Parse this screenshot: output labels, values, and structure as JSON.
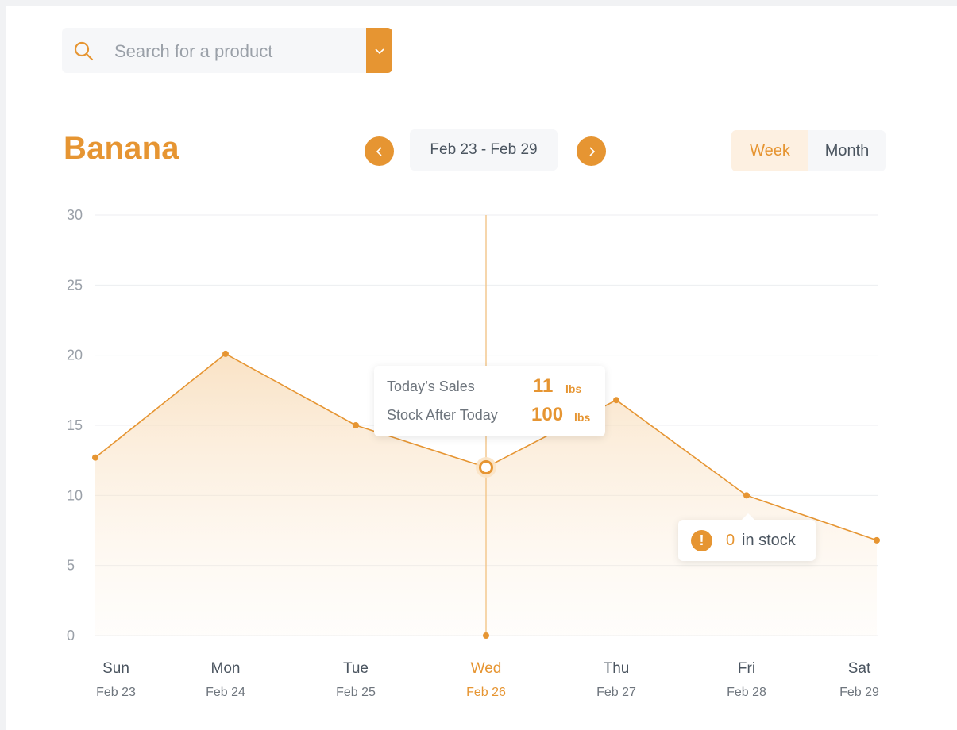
{
  "search": {
    "placeholder": "Search for a product",
    "icon": "search-icon",
    "dropdown_icon": "chevron-down-icon"
  },
  "product": {
    "title": "Banana"
  },
  "date_nav": {
    "range": "Feb 23 - Feb 29",
    "prev_icon": "chevron-left-icon",
    "next_icon": "chevron-right-icon"
  },
  "view_toggle": {
    "options": [
      "Week",
      "Month"
    ],
    "active": "Week"
  },
  "tooltip": {
    "sales_label": "Today’s Sales",
    "sales_value": "11",
    "sales_unit": "lbs",
    "stock_label": "Stock After Today",
    "stock_value": "100",
    "stock_unit": "lbs"
  },
  "stock_alert": {
    "icon": "warning-icon",
    "glyph": "!",
    "qty": "0",
    "text": "in stock"
  },
  "colors": {
    "accent": "#e69532",
    "accent_light": "#fdf0e1",
    "grid": "#eceef0"
  },
  "chart_data": {
    "type": "area",
    "categories": [
      "Sun",
      "Mon",
      "Tue",
      "Wed",
      "Thu",
      "Fri",
      "Sat"
    ],
    "dates": [
      "Feb 23",
      "Feb 24",
      "Feb 25",
      "Feb 26",
      "Feb 27",
      "Feb 28",
      "Feb 29"
    ],
    "values": [
      12.7,
      20.1,
      15,
      12,
      16.8,
      10,
      6.8
    ],
    "highlighted_category": "Wed",
    "ylim": [
      0,
      30
    ],
    "yticks": [
      0,
      5,
      10,
      15,
      20,
      25,
      30
    ],
    "grid": true
  }
}
